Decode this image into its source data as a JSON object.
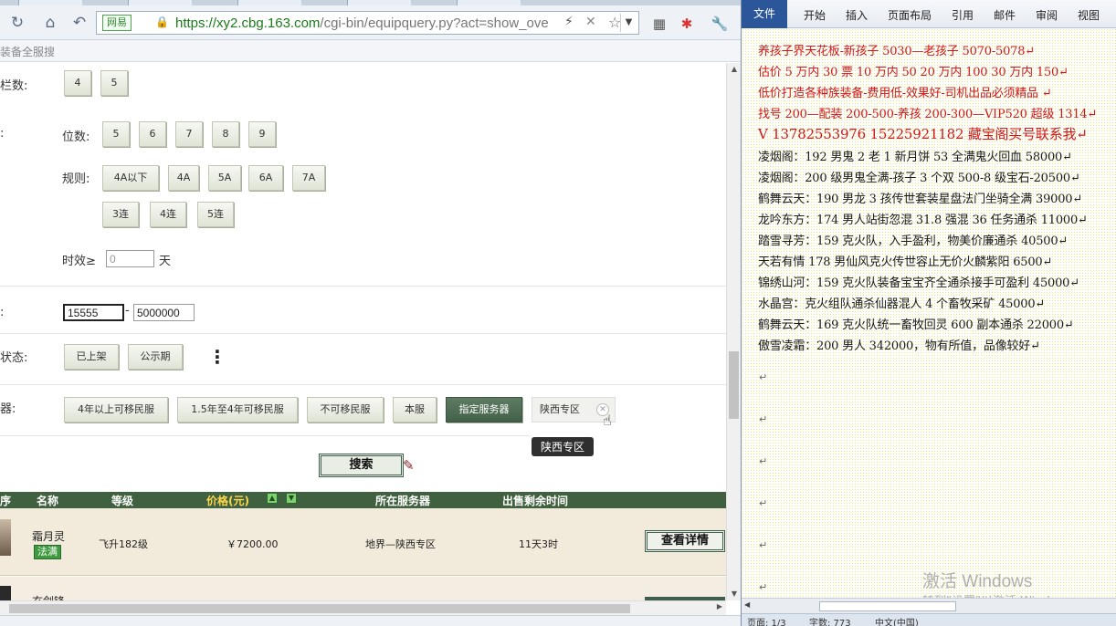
{
  "browser": {
    "url_site_badge": "网易",
    "url_prefix": "https://xy2.cbg.163.com",
    "url_rest": "/cgi-bin/equipquery.py?act=show_ove",
    "bookmark_text": "装备全服搜"
  },
  "form": {
    "row1_label": "栏数:",
    "row1_buttons": [
      "4",
      "5"
    ],
    "row2_label": ":",
    "digits_label": "位数:",
    "digits_buttons": [
      "5",
      "6",
      "7",
      "8",
      "9"
    ],
    "rule_label": "规则:",
    "rule_buttons": [
      "4A以下",
      "4A",
      "5A",
      "6A",
      "7A"
    ],
    "seq_buttons": [
      "3连",
      "4连",
      "5连"
    ],
    "timeliness_label": "时效≥",
    "timeliness_value": "0",
    "timeliness_unit": "天",
    "price_label": ":",
    "price_min": "15555",
    "price_sep": "-",
    "price_max": "5000000",
    "status_label": "状态:",
    "status_buttons": [
      "已上架",
      "公示期"
    ],
    "more_icon": "⋮",
    "server_label": "器:",
    "server_buttons": [
      "4年以上可移民服",
      "1.5年至4年可移民服",
      "不可移民服",
      "本服",
      "指定服务器"
    ],
    "server_active": "指定服务器",
    "server_chip": "陕西专区",
    "chip_tooltip": "陕西专区",
    "search_label": "搜索"
  },
  "table": {
    "headers": {
      "index": "序",
      "name": "名称",
      "level": "等级",
      "price": "价格(元)",
      "server": "所在服务器",
      "time_left": "出售剩余时间"
    },
    "rows": [
      {
        "name": "霜月灵",
        "badge": "法满",
        "level": "飞升182级",
        "price": "￥7200.00",
        "server": "地界—陕西专区",
        "time_left": "11天3时",
        "action": "查看详情"
      },
      {
        "name": "玄剑锋",
        "badge": "",
        "level": "",
        "price": "",
        "server": "",
        "time_left": "",
        "action": ""
      }
    ]
  },
  "word": {
    "tabs": [
      "文件",
      "开始",
      "插入",
      "页面布局",
      "引用",
      "邮件",
      "审阅",
      "视图"
    ],
    "lines": [
      {
        "text": "养孩子界天花板-新孩子 5030—老孩子 5070-5078↵",
        "style": "red"
      },
      {
        "text": "估价 5 万内 30 票  10 万内 50  20 万内 100  30 万内 150↵",
        "style": "red"
      },
      {
        "text": "低价打造各种族装备-费用低-效果好-司机出品必须精品  ↵",
        "style": "red"
      },
      {
        "text": "找号 200—配装 200-500-养孩 200-300—VIP520 超级 1314↵",
        "style": "red"
      },
      {
        "text": "V 13782553976   15225921182  藏宝阁买号联系我↵",
        "style": "red big"
      },
      {
        "text": "凌烟阁：192 男鬼 2 老 1 新月饼 53 全满鬼火回血 58000↵",
        "style": ""
      },
      {
        "text": "凌烟阁：200 级男鬼全满-孩子 3 个双 500-8 级宝石-20500↵",
        "style": ""
      },
      {
        "text": "鹤舞云天：190 男龙 3 孩传世套装星盘法门坐骑全满 39000↵",
        "style": ""
      },
      {
        "text": "龙吟东方：174 男人站街忽混 31.8 强混 36 任务通杀 11000↵",
        "style": ""
      },
      {
        "text": "踏雪寻芳：159 克火队，入手盈利，物美价廉通杀 40500↵",
        "style": ""
      },
      {
        "text": "天若有情 178 男仙风克火传世容止无价火麟紫阳 6500↵",
        "style": ""
      },
      {
        "text": "锦绣山河：159 克火队装备宝宝齐全通杀接手可盈利 45000↵",
        "style": ""
      },
      {
        "text": "水晶宫：克火组队通杀仙器混人 4 个畜牧采矿 45000↵",
        "style": ""
      },
      {
        "text": "鹤舞云天：169 克火队统一畜牧回灵 600 副本通杀 22000↵",
        "style": ""
      },
      {
        "text": "傲雪凌霜：200 男人 342000，物有所值，品像较好↵",
        "style": ""
      }
    ],
    "para_mark": "↵",
    "watermark_line1": "激活 Windows",
    "watermark_line2": "转到\"设置\"以激活 Windows。",
    "status": {
      "page": "页面: 1/3",
      "words": "字数: 773",
      "lang": "中文(中国)"
    }
  }
}
